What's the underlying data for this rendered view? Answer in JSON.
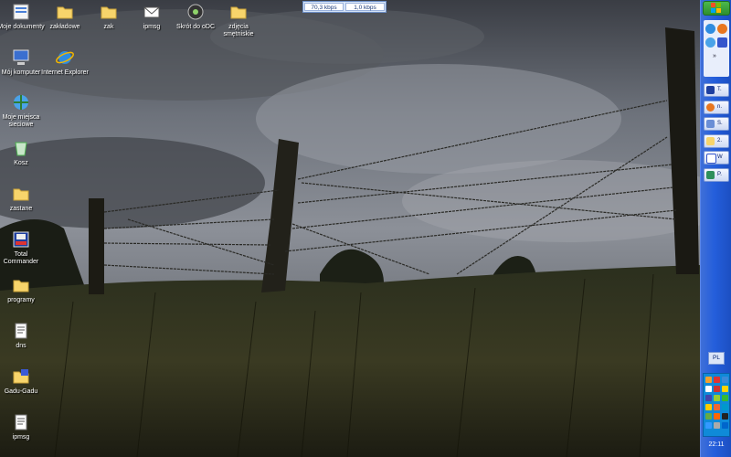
{
  "desktop_icons": [
    {
      "label": "Moje dokumenty",
      "icon": "my-documents-icon"
    },
    {
      "label": "Mój komputer",
      "icon": "my-computer-icon"
    },
    {
      "label": "Moje miejsca sieciowe",
      "icon": "network-places-icon"
    },
    {
      "label": "Kosz",
      "icon": "recycle-bin-icon"
    },
    {
      "label": "zastane",
      "icon": "folder-icon"
    },
    {
      "label": "Total Commander",
      "icon": "total-commander-icon"
    },
    {
      "label": "programy",
      "icon": "folder-icon"
    },
    {
      "label": "dns",
      "icon": "text-file-icon"
    },
    {
      "label": "Gadu-Gadu",
      "icon": "gadu-gadu-icon"
    },
    {
      "label": "ipmsg",
      "icon": "text-file-icon"
    },
    {
      "label": "Internet Explorer",
      "icon": "internet-explorer-icon"
    },
    {
      "label": "zakładowe",
      "icon": "folder-icon"
    },
    {
      "label": "zak",
      "icon": "folder-icon"
    },
    {
      "label": "ipmsg",
      "icon": "envelope-icon"
    },
    {
      "label": "Skrót do oDC",
      "icon": "shortcut-dc-icon"
    },
    {
      "label": "zdjęcia smętniskie",
      "icon": "folder-icon"
    }
  ],
  "net_meter": {
    "download": "70,3 kbps",
    "upload": "1,0 kbps"
  },
  "taskbar": {
    "tasks": [
      {
        "label": "T.",
        "icon": "total-commander-icon"
      },
      {
        "label": "n.",
        "icon": "firefox-icon"
      },
      {
        "label": "S.",
        "icon": "window-icon"
      },
      {
        "label": "2.",
        "icon": "folder-icon"
      },
      {
        "label": "W",
        "icon": "document-icon"
      },
      {
        "label": "P.",
        "icon": "image-icon"
      }
    ],
    "language": "PL",
    "clock": "22:11"
  },
  "colors": {
    "taskbar_blue": "#245edb",
    "start_green": "#2e8f2e",
    "tray_blue": "#0f8ad8"
  }
}
